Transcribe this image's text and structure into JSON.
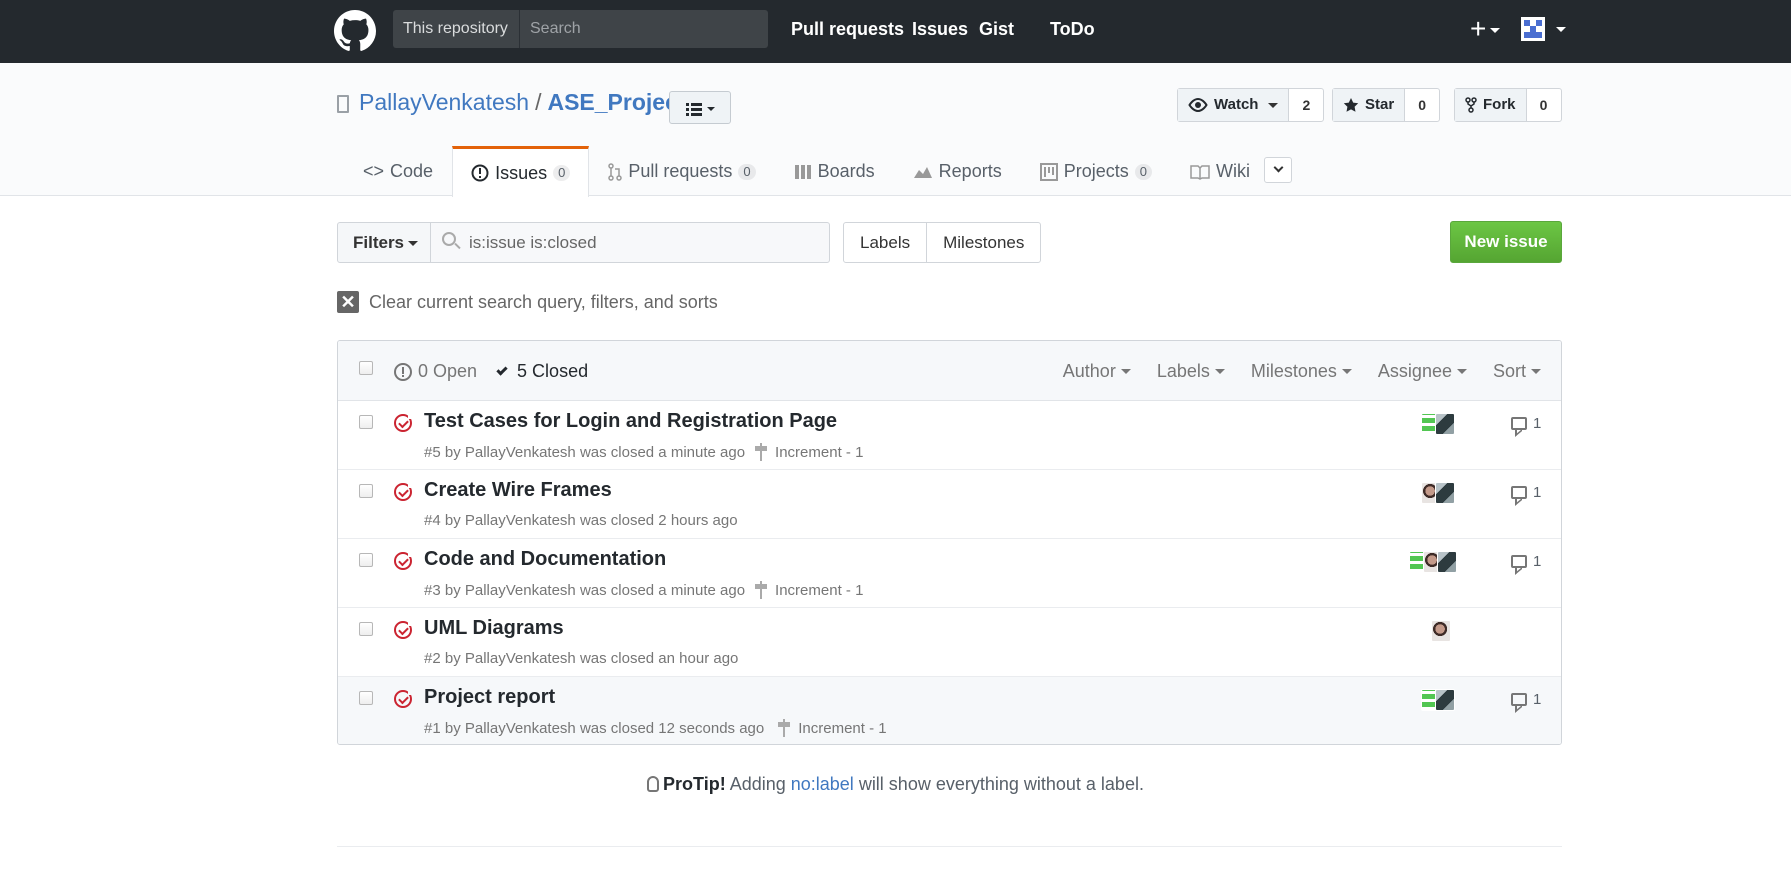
{
  "header": {
    "scope_label": "This repository",
    "search_placeholder": "Search",
    "nav": [
      "Pull requests",
      "Issues",
      "Gist",
      "ToDo"
    ],
    "plus_symbol": "+"
  },
  "repo": {
    "owner": "PallayVenkatesh",
    "separator": "/",
    "name": "ASE_Project",
    "watch_label": "Watch",
    "watch_count": "2",
    "star_label": "Star",
    "star_count": "0",
    "fork_label": "Fork",
    "fork_count": "0"
  },
  "tabs": {
    "code": "Code",
    "issues": "Issues",
    "issues_count": "0",
    "pulls": "Pull requests",
    "pulls_count": "0",
    "boards": "Boards",
    "reports": "Reports",
    "projects": "Projects",
    "projects_count": "0",
    "wiki": "Wiki"
  },
  "filters": {
    "button": "Filters",
    "query": "is:issue is:closed",
    "labels": "Labels",
    "milestones": "Milestones",
    "new_issue": "New issue",
    "clear": "Clear current search query, filters, and sorts",
    "clear_symbol": "✕"
  },
  "list": {
    "open_label": "0 Open",
    "closed_label": "5 Closed",
    "sorts": [
      "Author",
      "Labels",
      "Milestones",
      "Assignee",
      "Sort"
    ]
  },
  "issues": [
    {
      "title": "Test Cases for Login and Registration Page",
      "meta": "#5 by PallayVenkatesh was closed a minute ago",
      "milestone": "Increment - 1",
      "comments": "1"
    },
    {
      "title": "Create Wire Frames",
      "meta": "#4 by PallayVenkatesh was closed 2 hours ago",
      "milestone": "",
      "comments": "1"
    },
    {
      "title": "Code and Documentation",
      "meta": "#3 by PallayVenkatesh was closed a minute ago",
      "milestone": "Increment - 1",
      "comments": "1"
    },
    {
      "title": "UML Diagrams",
      "meta": "#2 by PallayVenkatesh was closed an hour ago",
      "milestone": "",
      "comments": ""
    },
    {
      "title": "Project report",
      "meta": "#1 by PallayVenkatesh was closed 12 seconds ago",
      "milestone": "Increment - 1",
      "comments": "1"
    }
  ],
  "protip": {
    "lead": "ProTip!",
    "pre": " Adding ",
    "link": "no:label",
    "post": " will show everything without a label."
  },
  "colors": {
    "accent": "#4078c0",
    "closed": "#cb2431",
    "new_issue": "#6cc644",
    "selected_tab": "#e36209"
  }
}
